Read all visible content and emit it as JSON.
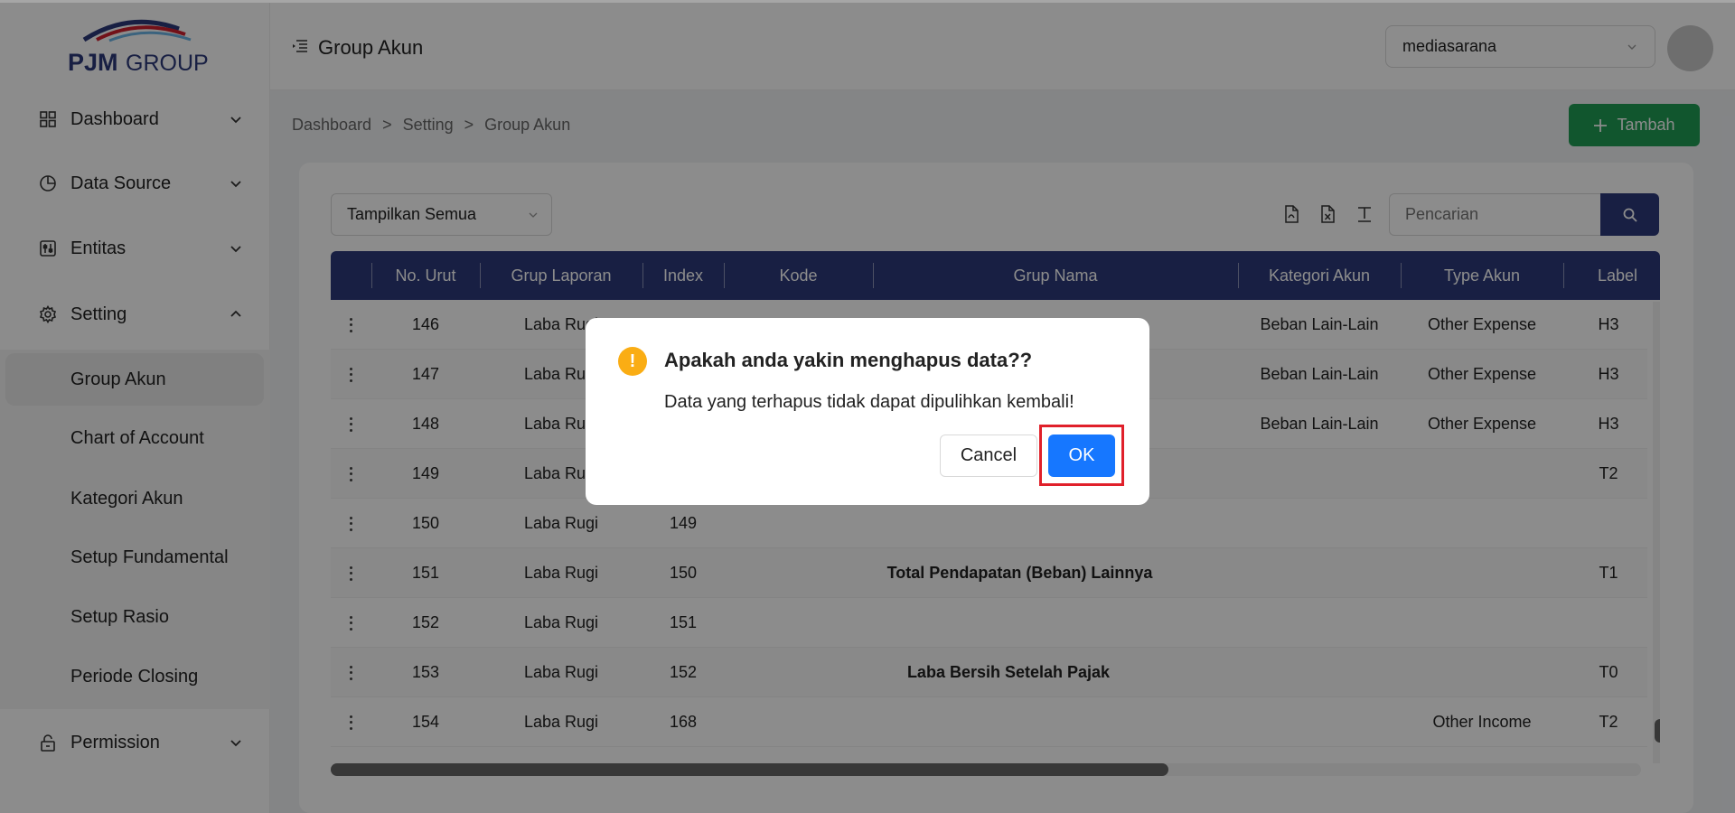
{
  "logo": {
    "text_pjm": "PJM",
    "text_group": "GROUP"
  },
  "sidebar": {
    "items": [
      {
        "label": "Dashboard",
        "icon": "grid-icon"
      },
      {
        "label": "Data Source",
        "icon": "pie-chart-icon"
      },
      {
        "label": "Entitas",
        "icon": "sliders-icon"
      },
      {
        "label": "Setting",
        "icon": "gear-icon"
      },
      {
        "label": "Permission",
        "icon": "lock-icon"
      }
    ],
    "setting_sub": [
      {
        "label": "Group Akun",
        "active": true
      },
      {
        "label": "Chart of Account"
      },
      {
        "label": "Kategori Akun"
      },
      {
        "label": "Setup Fundamental"
      },
      {
        "label": "Setup Rasio"
      },
      {
        "label": "Periode Closing"
      }
    ]
  },
  "header": {
    "title": "Group Akun",
    "company": "mediasarana"
  },
  "breadcrumb": [
    "Dashboard",
    ">",
    "Setting",
    ">",
    "Group Akun"
  ],
  "toolbar": {
    "add_label": "Tambah",
    "filter_value": "Tampilkan Semua",
    "search_placeholder": "Pencarian"
  },
  "table": {
    "columns": [
      "No. Urut",
      "Grup Laporan",
      "Index",
      "Kode",
      "Grup Nama",
      "Kategori Akun",
      "Type Akun",
      "Label"
    ],
    "rows": [
      {
        "no": "146",
        "grup": "Laba Rugi",
        "index": "",
        "kode": "",
        "nama": "",
        "kategori": "Beban Lain-Lain",
        "type": "Other Expense",
        "label": "H3"
      },
      {
        "no": "147",
        "grup": "Laba Rugi",
        "index": "",
        "kode": "",
        "nama": "",
        "kategori": "Beban Lain-Lain",
        "type": "Other Expense",
        "label": "H3"
      },
      {
        "no": "148",
        "grup": "Laba Rugi",
        "index": "",
        "kode": "",
        "nama": "",
        "kategori": "Beban Lain-Lain",
        "type": "Other Expense",
        "label": "H3"
      },
      {
        "no": "149",
        "grup": "Laba Rugi",
        "index": "",
        "kode": "",
        "nama": "",
        "kategori": "",
        "type": "",
        "label": "T2"
      },
      {
        "no": "150",
        "grup": "Laba Rugi",
        "index": "149",
        "kode": "",
        "nama": "",
        "kategori": "",
        "type": "",
        "label": ""
      },
      {
        "no": "151",
        "grup": "Laba Rugi",
        "index": "150",
        "kode": "",
        "nama": "Total Pendapatan (Beban) Lainnya",
        "kategori": "",
        "type": "",
        "label": "T1"
      },
      {
        "no": "152",
        "grup": "Laba Rugi",
        "index": "151",
        "kode": "",
        "nama": "",
        "kategori": "",
        "type": "",
        "label": ""
      },
      {
        "no": "153",
        "grup": "Laba Rugi",
        "index": "152",
        "kode": "",
        "nama": "Laba Bersih Setelah Pajak",
        "kategori": "",
        "type": "",
        "label": "T0"
      },
      {
        "no": "154",
        "grup": "Laba Rugi",
        "index": "168",
        "kode": "",
        "nama": "",
        "kategori": "",
        "type": "Other Income",
        "label": "T2"
      }
    ]
  },
  "modal": {
    "title": "Apakah anda yakin menghapus data??",
    "text": "Data yang terhapus tidak dapat dipulihkan kembali!",
    "cancel_label": "Cancel",
    "ok_label": "OK",
    "icon_glyph": "!"
  },
  "colors": {
    "primary_navy": "#2d3a7a",
    "add_green": "#1f9d55",
    "ok_blue": "#1677ff",
    "warn_orange": "#faad14",
    "highlight_red": "#e0202a"
  }
}
